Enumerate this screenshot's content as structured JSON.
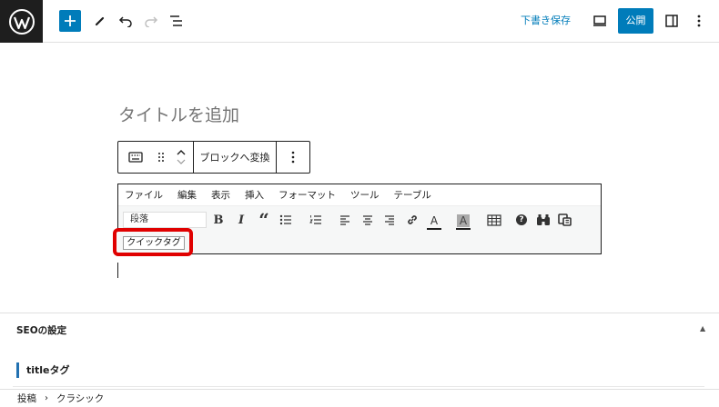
{
  "header": {
    "icons": [
      "wordpress-logo",
      "plus-icon",
      "pencil-icon",
      "undo-icon",
      "redo-icon",
      "list-view-icon",
      "desktop-preview-icon",
      "settings-sidebar-icon",
      "more-vertical-icon"
    ],
    "save_draft_label": "下書き保存",
    "publish_label": "公開"
  },
  "editor": {
    "title_placeholder": "タイトルを追加",
    "block_toolbar": {
      "transform_label": "ブロックへ変換",
      "icons": [
        "keyboard-icon",
        "drag-handle-icon",
        "move-up-icon",
        "move-down-icon",
        "more-options-icon"
      ]
    },
    "classic_block": {
      "menu": [
        "ファイル",
        "編集",
        "表示",
        "挿入",
        "フォーマット",
        "ツール",
        "テーブル"
      ],
      "format_select_value": "段落",
      "tools": [
        "bold-icon",
        "italic-icon",
        "blockquote-icon",
        "bullet-list-icon",
        "numbered-list-icon",
        "align-left-icon",
        "align-center-icon",
        "align-right-icon",
        "link-icon",
        "text-color-icon",
        "background-color-icon",
        "table-icon",
        "help-icon",
        "find-icon",
        "paste-special-icon"
      ],
      "bold_glyph": "B",
      "italic_glyph": "I",
      "quote_glyph": "“",
      "text_color_glyph": "A",
      "bg_color_glyph": "A",
      "help_glyph": "?",
      "quicktag_label": "クイックタグ"
    }
  },
  "meta_box": {
    "title": "SEOの設定",
    "subheading": "titleタグ"
  },
  "breadcrumb": {
    "items": [
      "投稿",
      "クラシック"
    ],
    "separator": "›"
  },
  "colors": {
    "accent": "#007cba",
    "highlight": "#e00000",
    "dark": "#1e1e1e"
  }
}
